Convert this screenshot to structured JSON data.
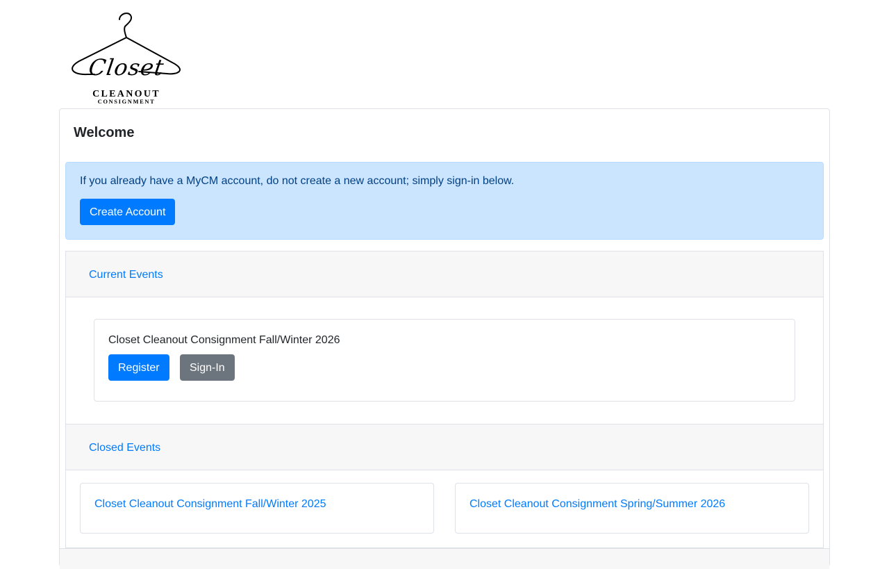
{
  "logo": {
    "script": "Closet",
    "line1": "CLEANOUT",
    "line2": "CONSIGNMENT"
  },
  "welcome": {
    "title": "Welcome"
  },
  "alert": {
    "message": "If you already have a MyCM account, do not create a new account; simply sign-in below.",
    "create_account_label": "Create Account"
  },
  "current_events": {
    "header": "Current Events",
    "events": [
      {
        "title": "Closet Cleanout Consignment Fall/Winter 2026",
        "register_label": "Register",
        "signin_label": "Sign-In"
      }
    ]
  },
  "closed_events": {
    "header": "Closed Events",
    "events": [
      {
        "title": "Closet Cleanout Consignment Fall/Winter 2025"
      },
      {
        "title": "Closet Cleanout Consignment Spring/Summer 2026"
      }
    ]
  },
  "colors": {
    "primary": "#007bff",
    "secondary": "#6c757d",
    "alert_bg": "#cce5ff",
    "alert_text": "#004085",
    "header_bg": "#f7f7f7"
  }
}
